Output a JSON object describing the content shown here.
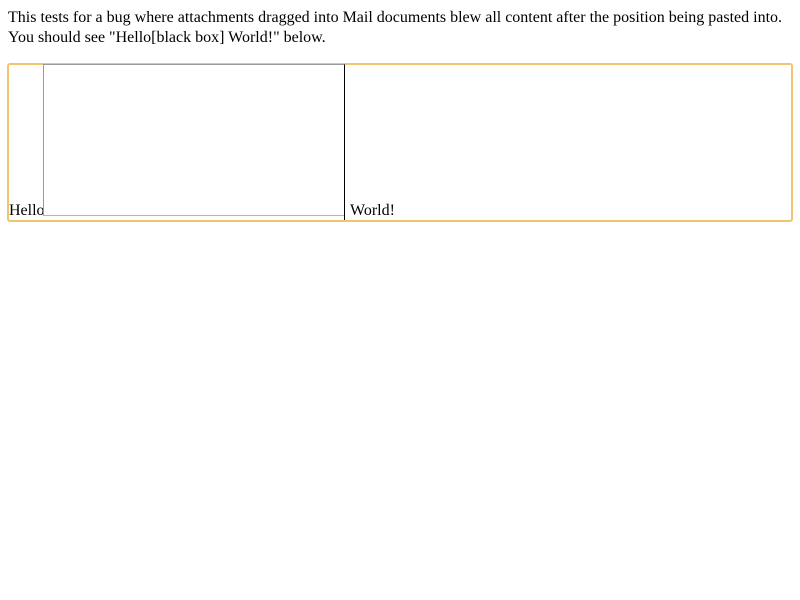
{
  "intro": {
    "line1": "This tests for a bug where attachments dragged into Mail documents blew all content after the position being pasted into.",
    "line2": "You should see \"Hello[black box] World!\" below."
  },
  "editor": {
    "text_before": "Hello",
    "text_after": "World!",
    "border_color": "#f3c46f"
  }
}
